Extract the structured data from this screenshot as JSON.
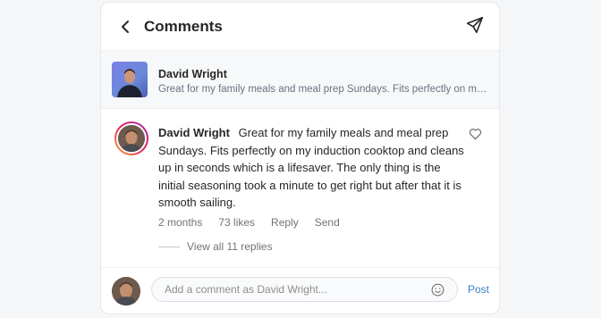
{
  "header": {
    "title": "Comments",
    "back_icon": "chevron-left-icon",
    "send_icon": "send-icon"
  },
  "post_preview": {
    "author": "David Wright",
    "caption": "Great for my family meals and meal prep Sundays. Fits perfectly on my induction cooktop and cleans up in seconds which is a lifesaver."
  },
  "comment": {
    "author": "David Wright",
    "text": "Great for my family meals and meal prep Sundays. Fits perfectly on my induction cooktop and cleans up in seconds which is a lifesaver. The only thing is the initial seasoning took a minute to get right but after that it is smooth sailing.",
    "time": "2 months",
    "likes": "73 likes",
    "reply_label": "Reply",
    "send_label": "Send",
    "view_replies": "View all 11 replies"
  },
  "footer": {
    "input_placeholder": "Add a comment as David Wright...",
    "input_value": "",
    "post_label": "Post"
  },
  "colors": {
    "accent": "#3b82c4",
    "muted": "#737373",
    "preview_bg": "#f6f8fa"
  }
}
